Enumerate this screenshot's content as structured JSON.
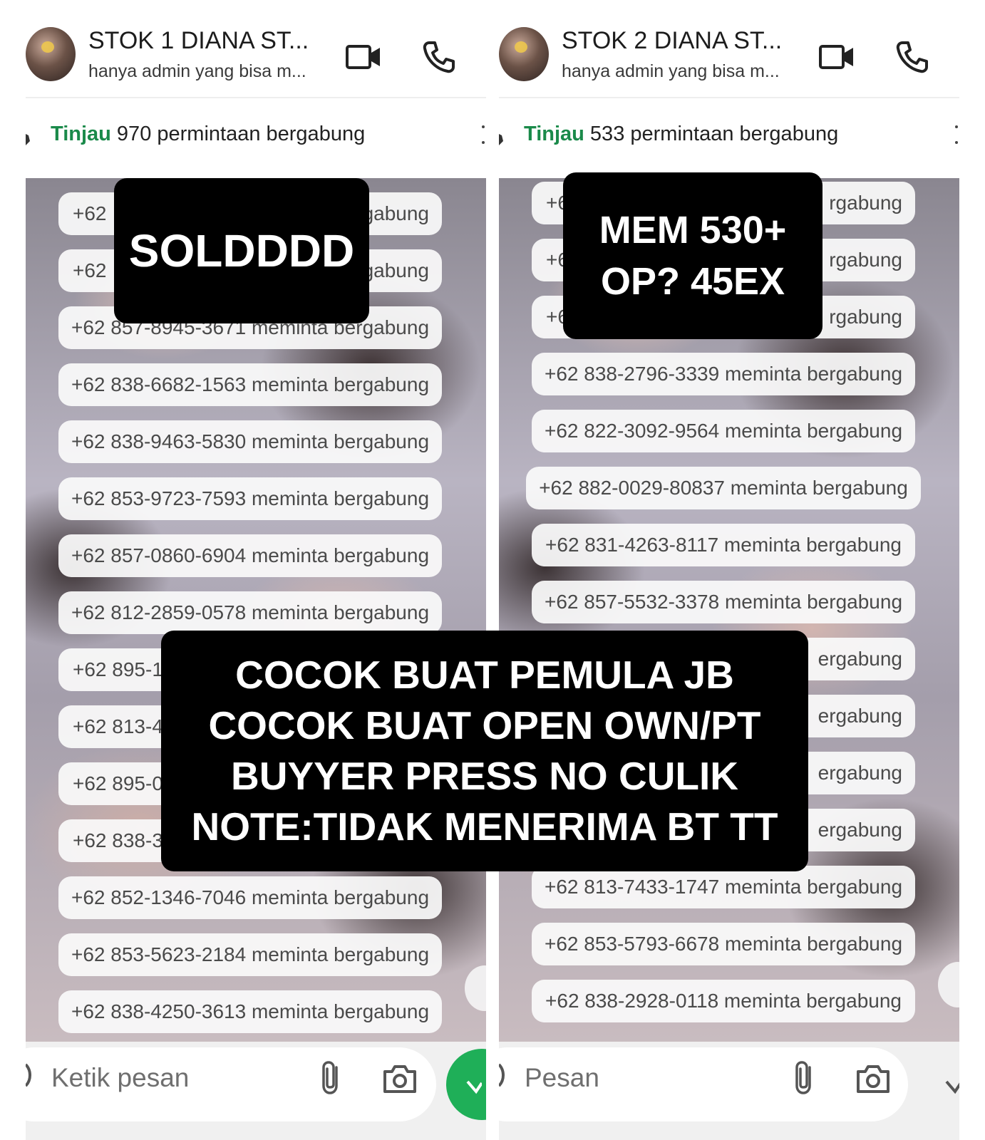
{
  "left": {
    "title": "STOK 1 DIANA ST...",
    "subtitle": "hanya admin yang bisa m...",
    "banner_link": "Tinjau",
    "banner_text": " 970 permintaan bergabung",
    "input_placeholder": "Ketik pesan",
    "requests": [
      "+62 ",
      "+62 ",
      "+62 857-8945-3671 meminta bergabung",
      "+62 838-6682-1563 meminta bergabung",
      "+62 838-9463-5830 meminta bergabung",
      "+62 853-9723-7593 meminta bergabung",
      "+62 857-0860-6904 meminta bergabung",
      "+62 812-2859-0578 meminta bergabung",
      "+62 895-1",
      "+62 813-4",
      "+62 895-0",
      "+62 838-3",
      "+62 852-1346-7046 meminta bergabung",
      "+62 853-5623-2184 meminta bergabung",
      "+62 838-4250-3613 meminta bergabung"
    ],
    "partial_suffix": "gabung"
  },
  "right": {
    "title": "STOK 2 DIANA ST...",
    "subtitle": "hanya admin yang bisa m...",
    "banner_link": "Tinjau",
    "banner_text": " 533 permintaan bergabung",
    "input_placeholder": "Pesan",
    "requests": [
      "+62",
      "+62",
      "+62",
      "+62 838-2796-3339 meminta bergabung",
      "+62 822-3092-9564 meminta bergabung",
      "+62 882-0029-80837 meminta bergabung",
      "+62 831-4263-8117 meminta bergabung",
      "+62 857-5532-3378 meminta bergabung",
      "ergabung",
      "ergabung",
      "ergabung",
      "ergabung",
      "+62 813-7433-1747 meminta bergabung",
      "+62 853-5793-6678 meminta bergabung",
      "+62 838-2928-0118 meminta bergabung"
    ],
    "partial_suffix": "rgabung"
  },
  "overlays": {
    "sold": "SOLDDDD",
    "mem_line1": "MEM 530+",
    "mem_line2": "OP? 45EX",
    "note_line1": "COCOK BUAT PEMULA JB",
    "note_line2": "COCOK BUAT OPEN OWN/PT",
    "note_line3": "BUYYER PRESS NO CULIK",
    "note_line4": "NOTE:TIDAK MENERIMA BT TT"
  },
  "colors": {
    "accent_green": "#1a8a4a",
    "send_green": "#1faf58",
    "overlay_bg": "#000000"
  },
  "icons": [
    "video-call-icon",
    "voice-call-icon",
    "attach-icon",
    "camera-icon",
    "menu-dots-icon",
    "emoji-icon",
    "scroll-down-icon"
  ]
}
